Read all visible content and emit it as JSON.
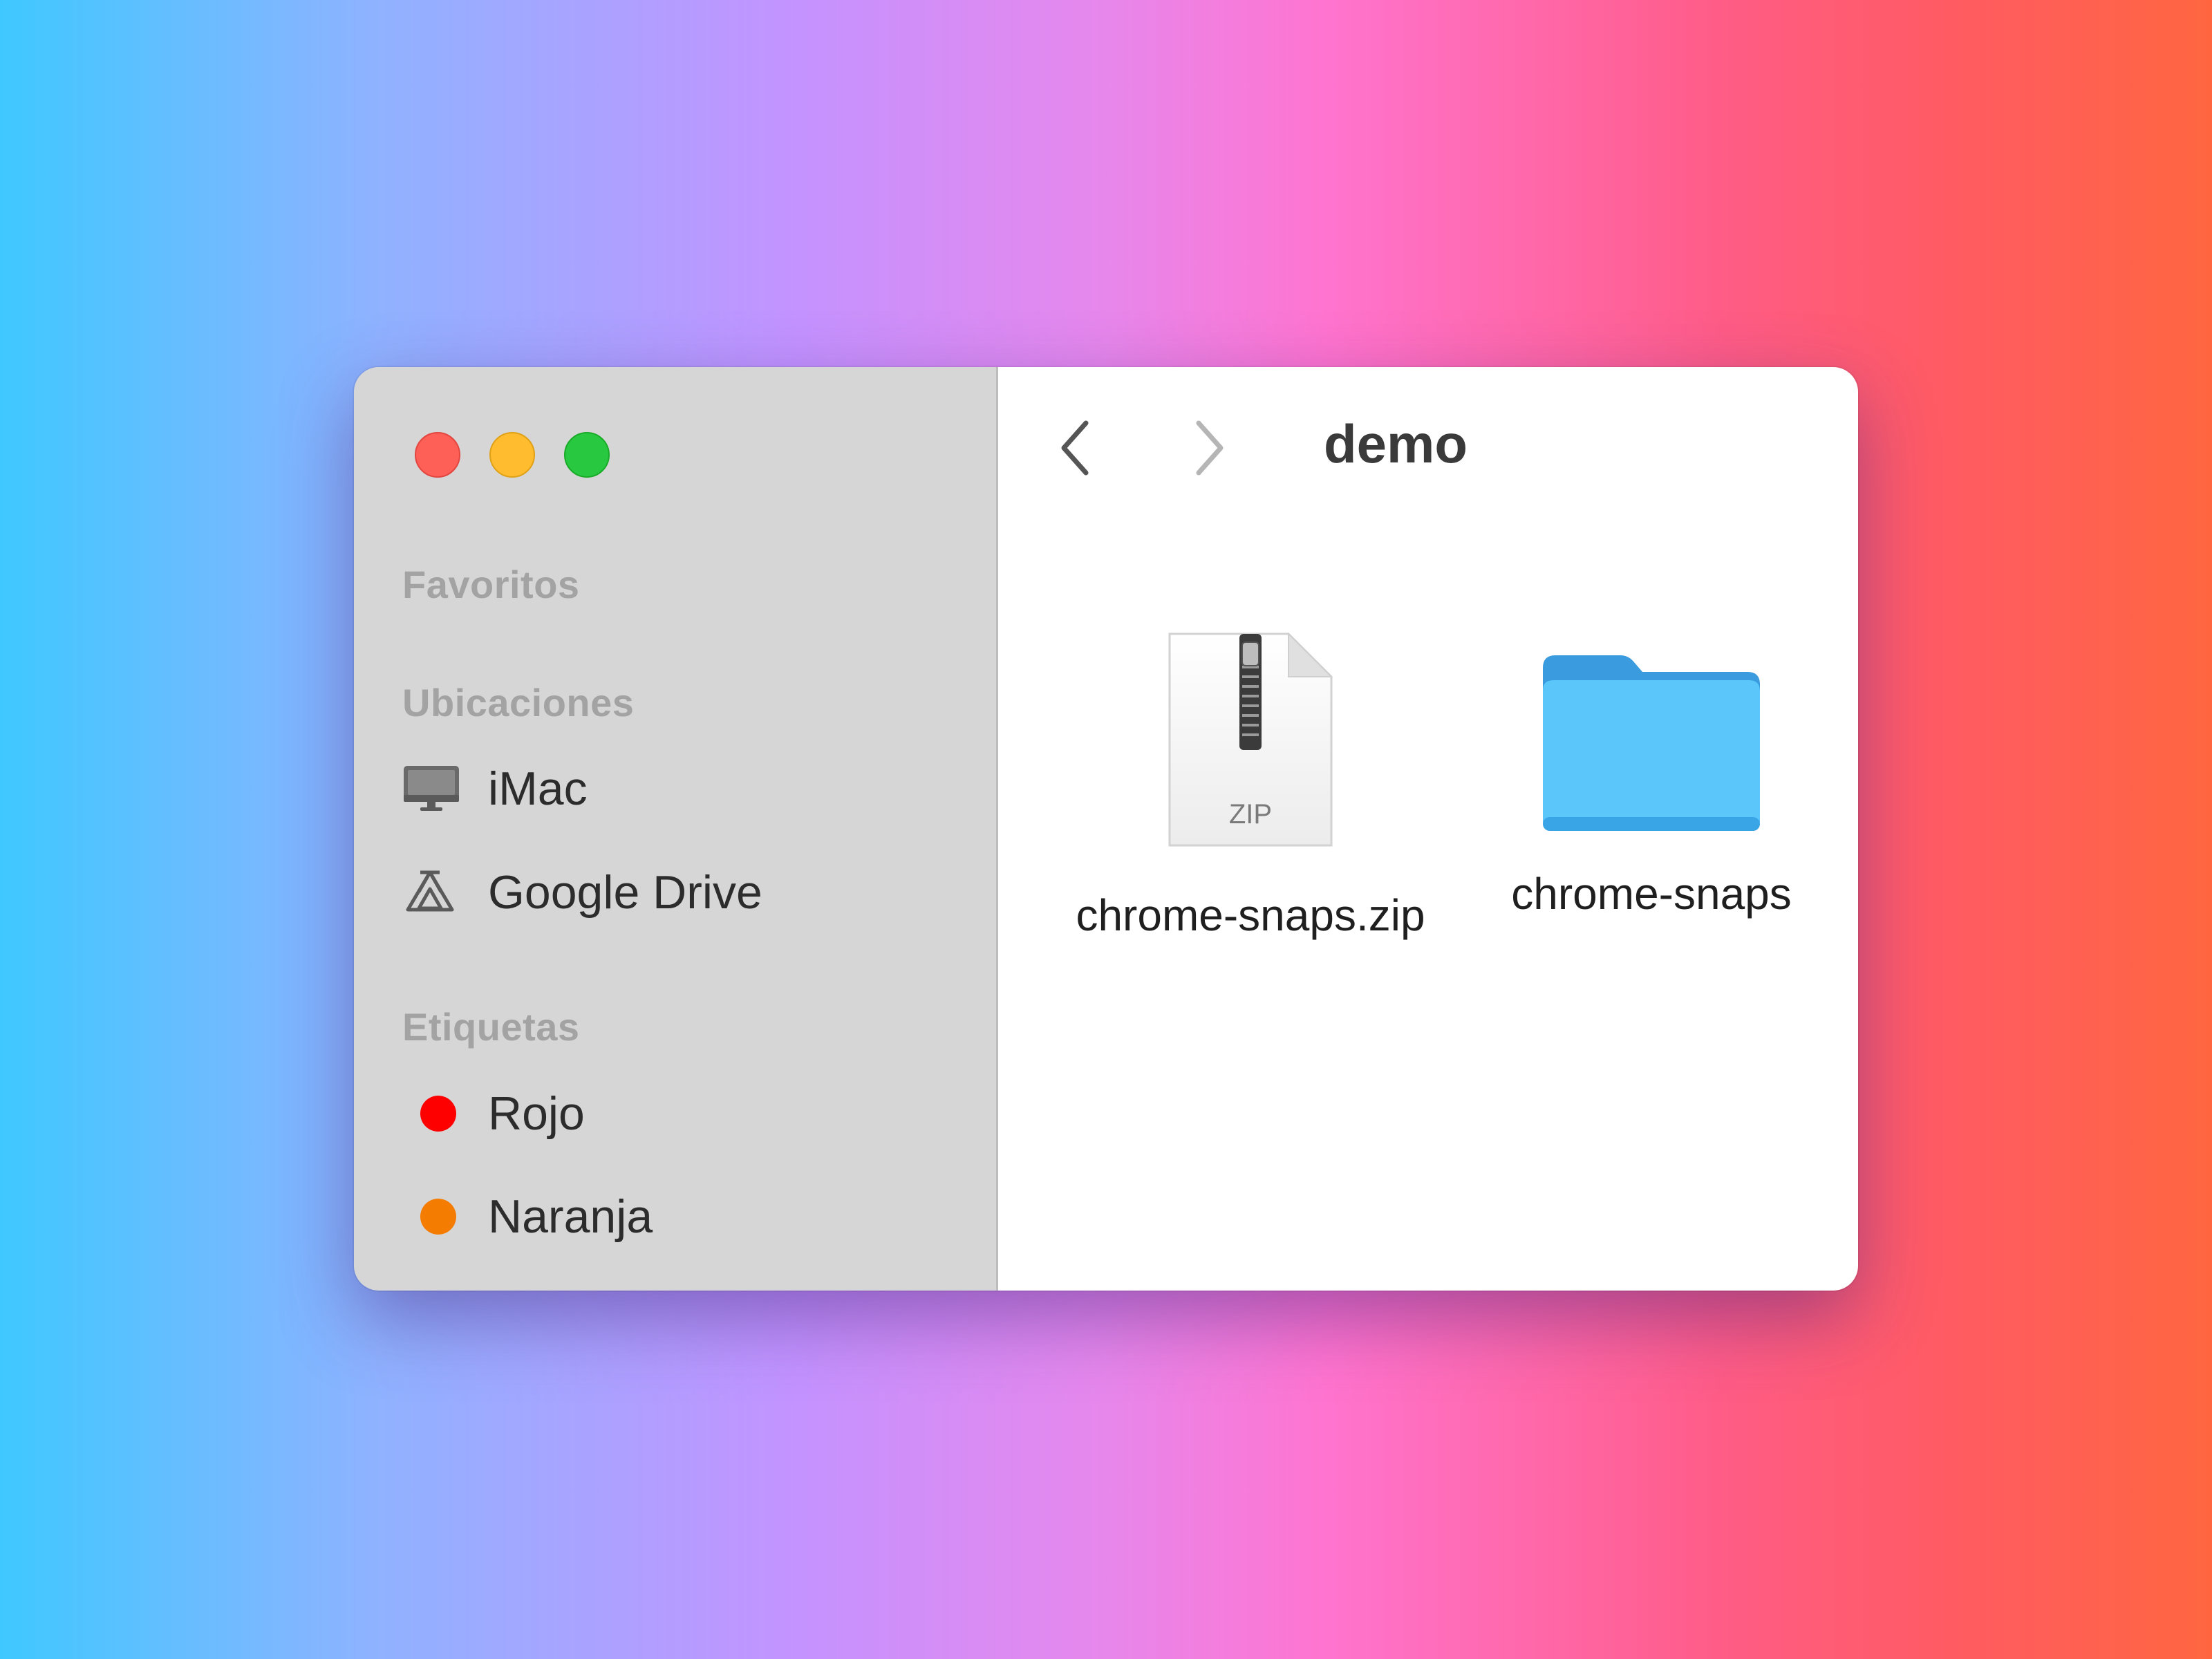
{
  "finder": {
    "window_title": "demo",
    "sidebar": {
      "favorites_title": "Favoritos",
      "locations_title": "Ubicaciones",
      "locations": [
        {
          "label": "iMac",
          "icon": "imac-icon"
        },
        {
          "label": "Google Drive",
          "icon": "google-drive-icon"
        }
      ],
      "tags_title": "Etiquetas",
      "tags": [
        {
          "label": "Rojo",
          "color": "#fe0000"
        },
        {
          "label": "Naranja",
          "color": "#f47c00"
        }
      ]
    },
    "files": [
      {
        "name": "chrome-snaps.zip",
        "type": "zip-archive",
        "icon": "zip-file-icon",
        "badge": "ZIP"
      },
      {
        "name": "chrome-snaps",
        "type": "folder",
        "icon": "folder-icon",
        "color": "#5ac6fa"
      }
    ]
  }
}
